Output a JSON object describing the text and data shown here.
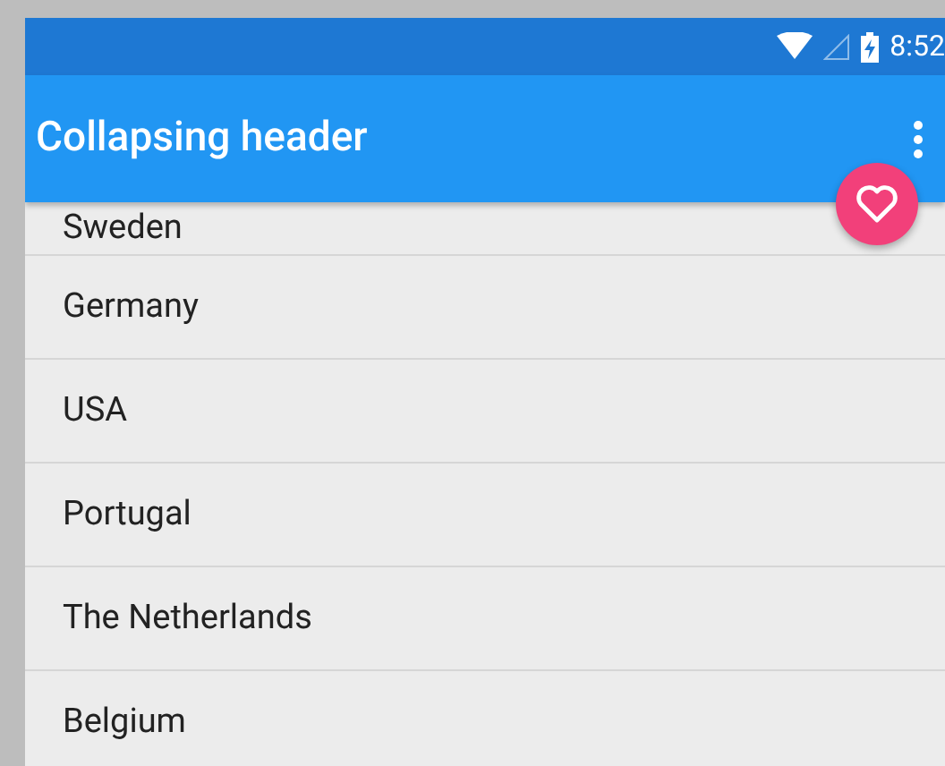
{
  "status_bar": {
    "time": "8:52"
  },
  "app_bar": {
    "title": "Collapsing header"
  },
  "list": {
    "items": [
      {
        "label": "Sweden"
      },
      {
        "label": "Germany"
      },
      {
        "label": "USA"
      },
      {
        "label": "Portugal"
      },
      {
        "label": "The Netherlands"
      },
      {
        "label": "Belgium"
      }
    ]
  }
}
